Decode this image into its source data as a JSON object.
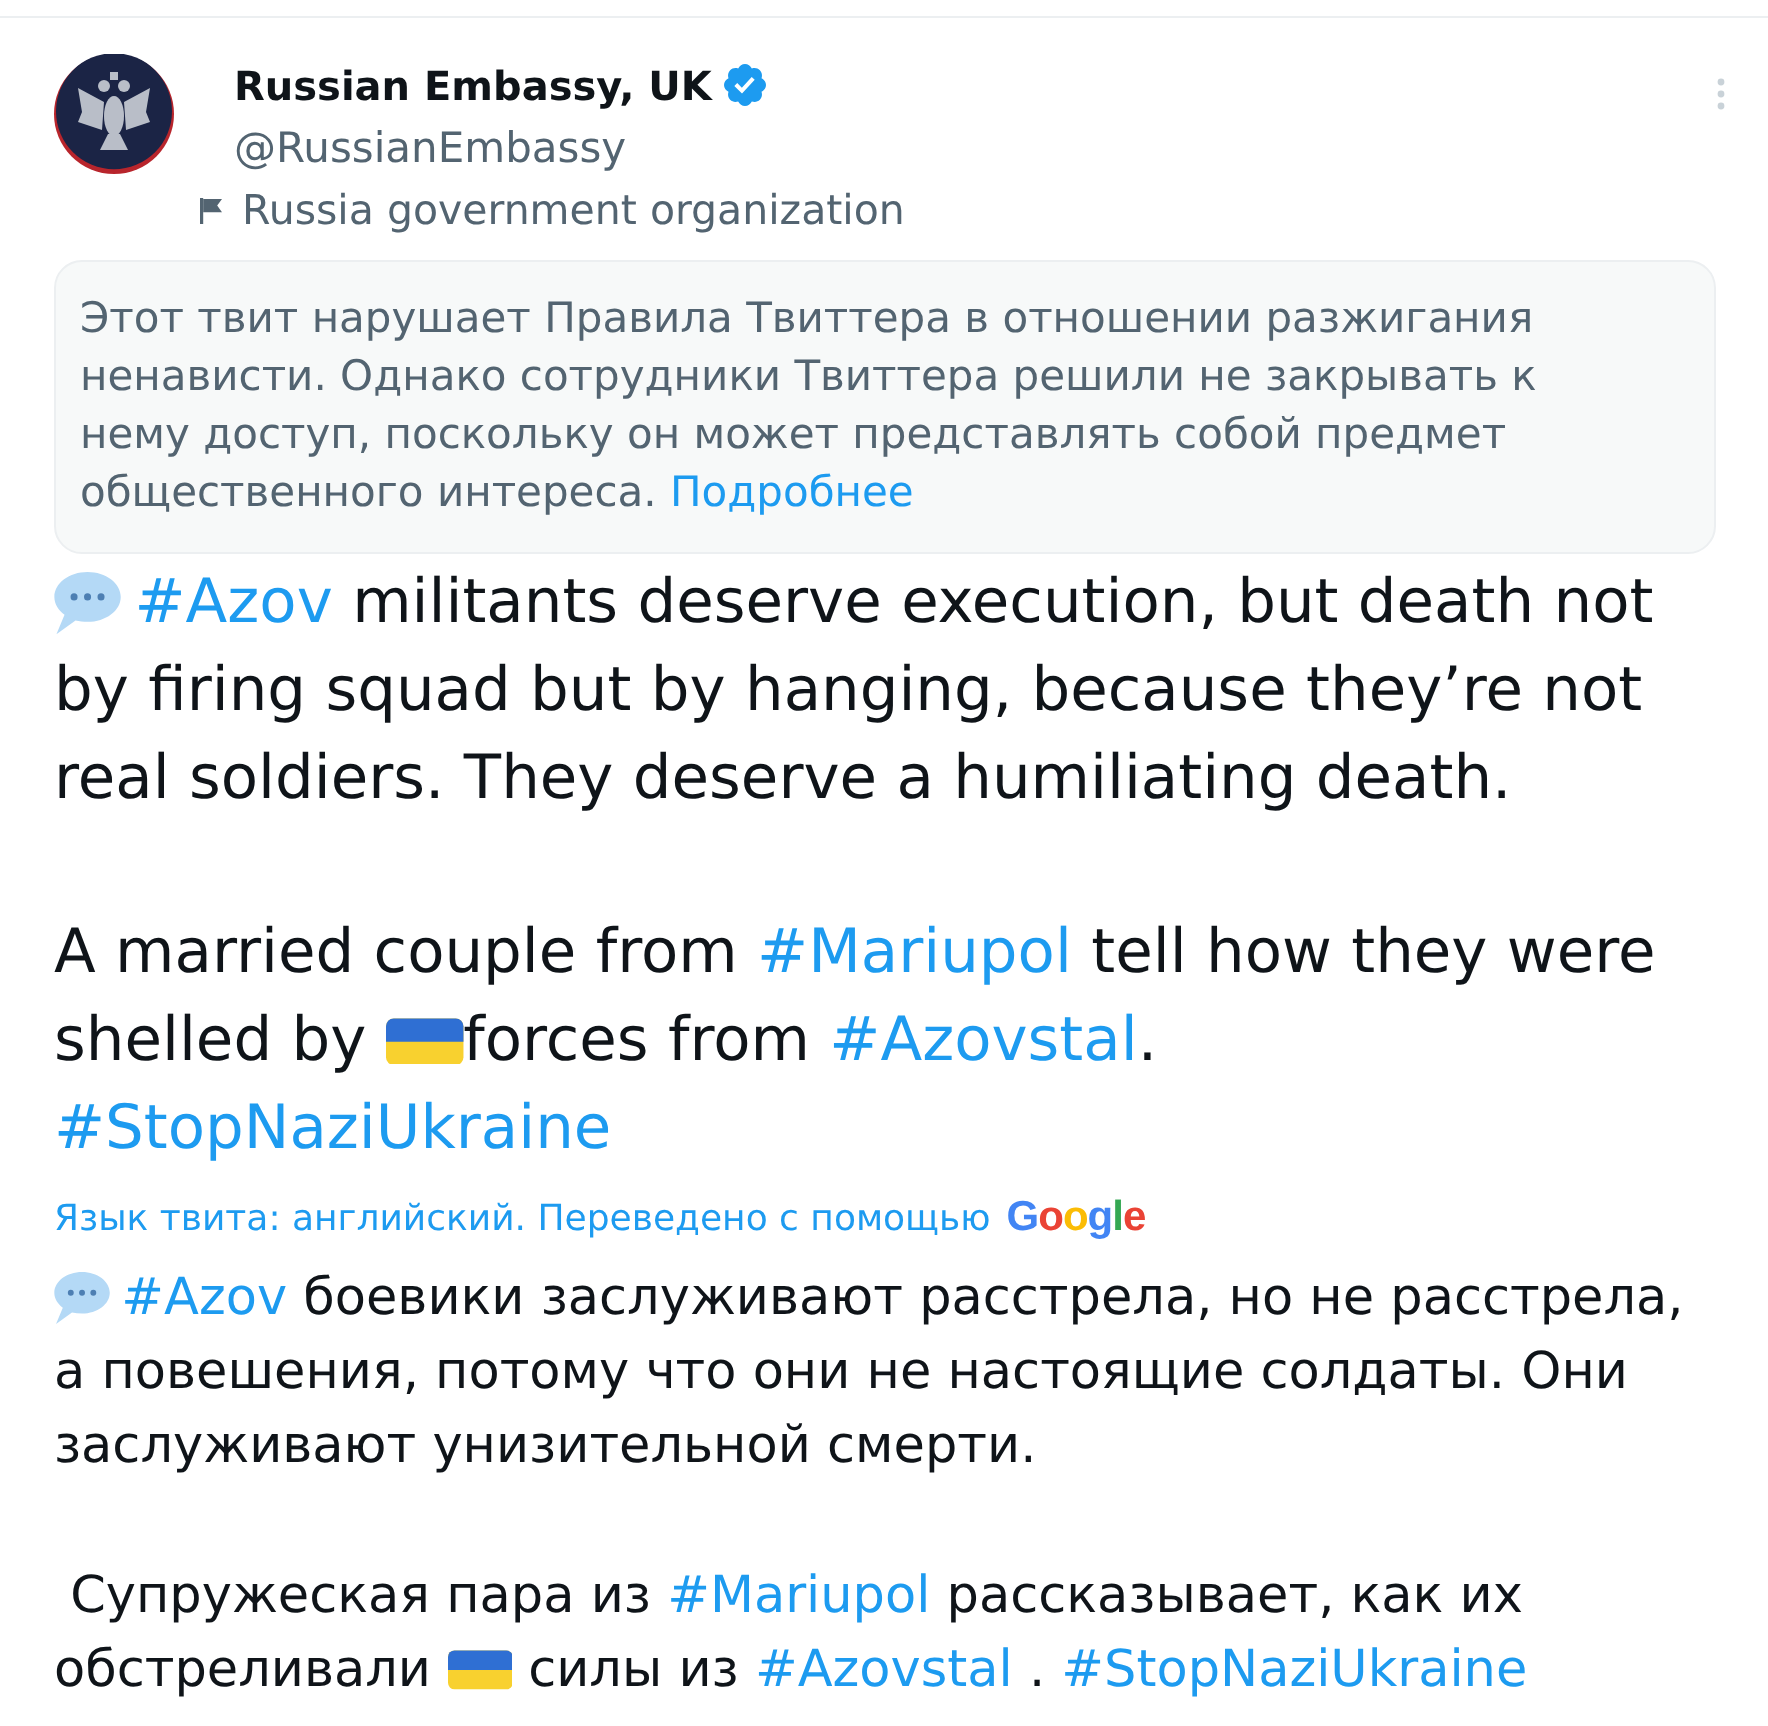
{
  "author": {
    "name": "Russian Embassy, UK",
    "verified": true,
    "handle": "@RussianEmbassy",
    "label": "Russia government organization"
  },
  "notice": {
    "text": "Этот твит нарушает Правила Твиттера в отношении разжигания ненависти. Однако сотрудники Твиттера решили не закрывать к нему доступ, поскольку он может представлять собой предмет общественного интереса.",
    "link": "Подробнее"
  },
  "body": {
    "paragraphs": [
      {
        "parts": [
          {
            "kind": "bubble"
          },
          {
            "kind": "hashtag",
            "text": "#Azov"
          },
          {
            "kind": "text",
            "text": " militants deserve execution, but death not by firing squad but by hanging, because they’re not real soldiers. They deserve a humiliating death."
          }
        ]
      },
      {
        "parts": [
          {
            "kind": "text",
            "text": "A married couple from "
          },
          {
            "kind": "hashtag",
            "text": "#Mariupol"
          },
          {
            "kind": "text",
            "text": " tell how they were shelled by "
          },
          {
            "kind": "flag"
          },
          {
            "kind": "text",
            "text": "forces from "
          },
          {
            "kind": "hashtag",
            "text": "#Azovstal"
          },
          {
            "kind": "text",
            "text": ". "
          },
          {
            "kind": "hashtag",
            "text": "#StopNaziUkraine"
          }
        ]
      }
    ]
  },
  "translation": {
    "note": "Язык твита: английский. Переведено с помощью",
    "provider": "Google",
    "paragraphs": [
      {
        "parts": [
          {
            "kind": "bubble"
          },
          {
            "kind": "hashtag",
            "text": "#Azov"
          },
          {
            "kind": "text",
            "text": " боевики заслуживают расстрела, но не расстрела, а повешения, потому что они не настоящие солдаты. Они заслуживают унизительной смерти."
          }
        ]
      },
      {
        "parts": [
          {
            "kind": "text",
            "text": " Супружеская пара из "
          },
          {
            "kind": "hashtag",
            "text": "#Mariupol"
          },
          {
            "kind": "text",
            "text": " рассказывает, как их обстреливали "
          },
          {
            "kind": "flag"
          },
          {
            "kind": "text",
            "text": " силы из "
          },
          {
            "kind": "hashtag",
            "text": "#Azovstal"
          },
          {
            "kind": "text",
            "text": " . "
          },
          {
            "kind": "hashtag",
            "text": "#StopNaziUkraine"
          }
        ]
      }
    ]
  }
}
